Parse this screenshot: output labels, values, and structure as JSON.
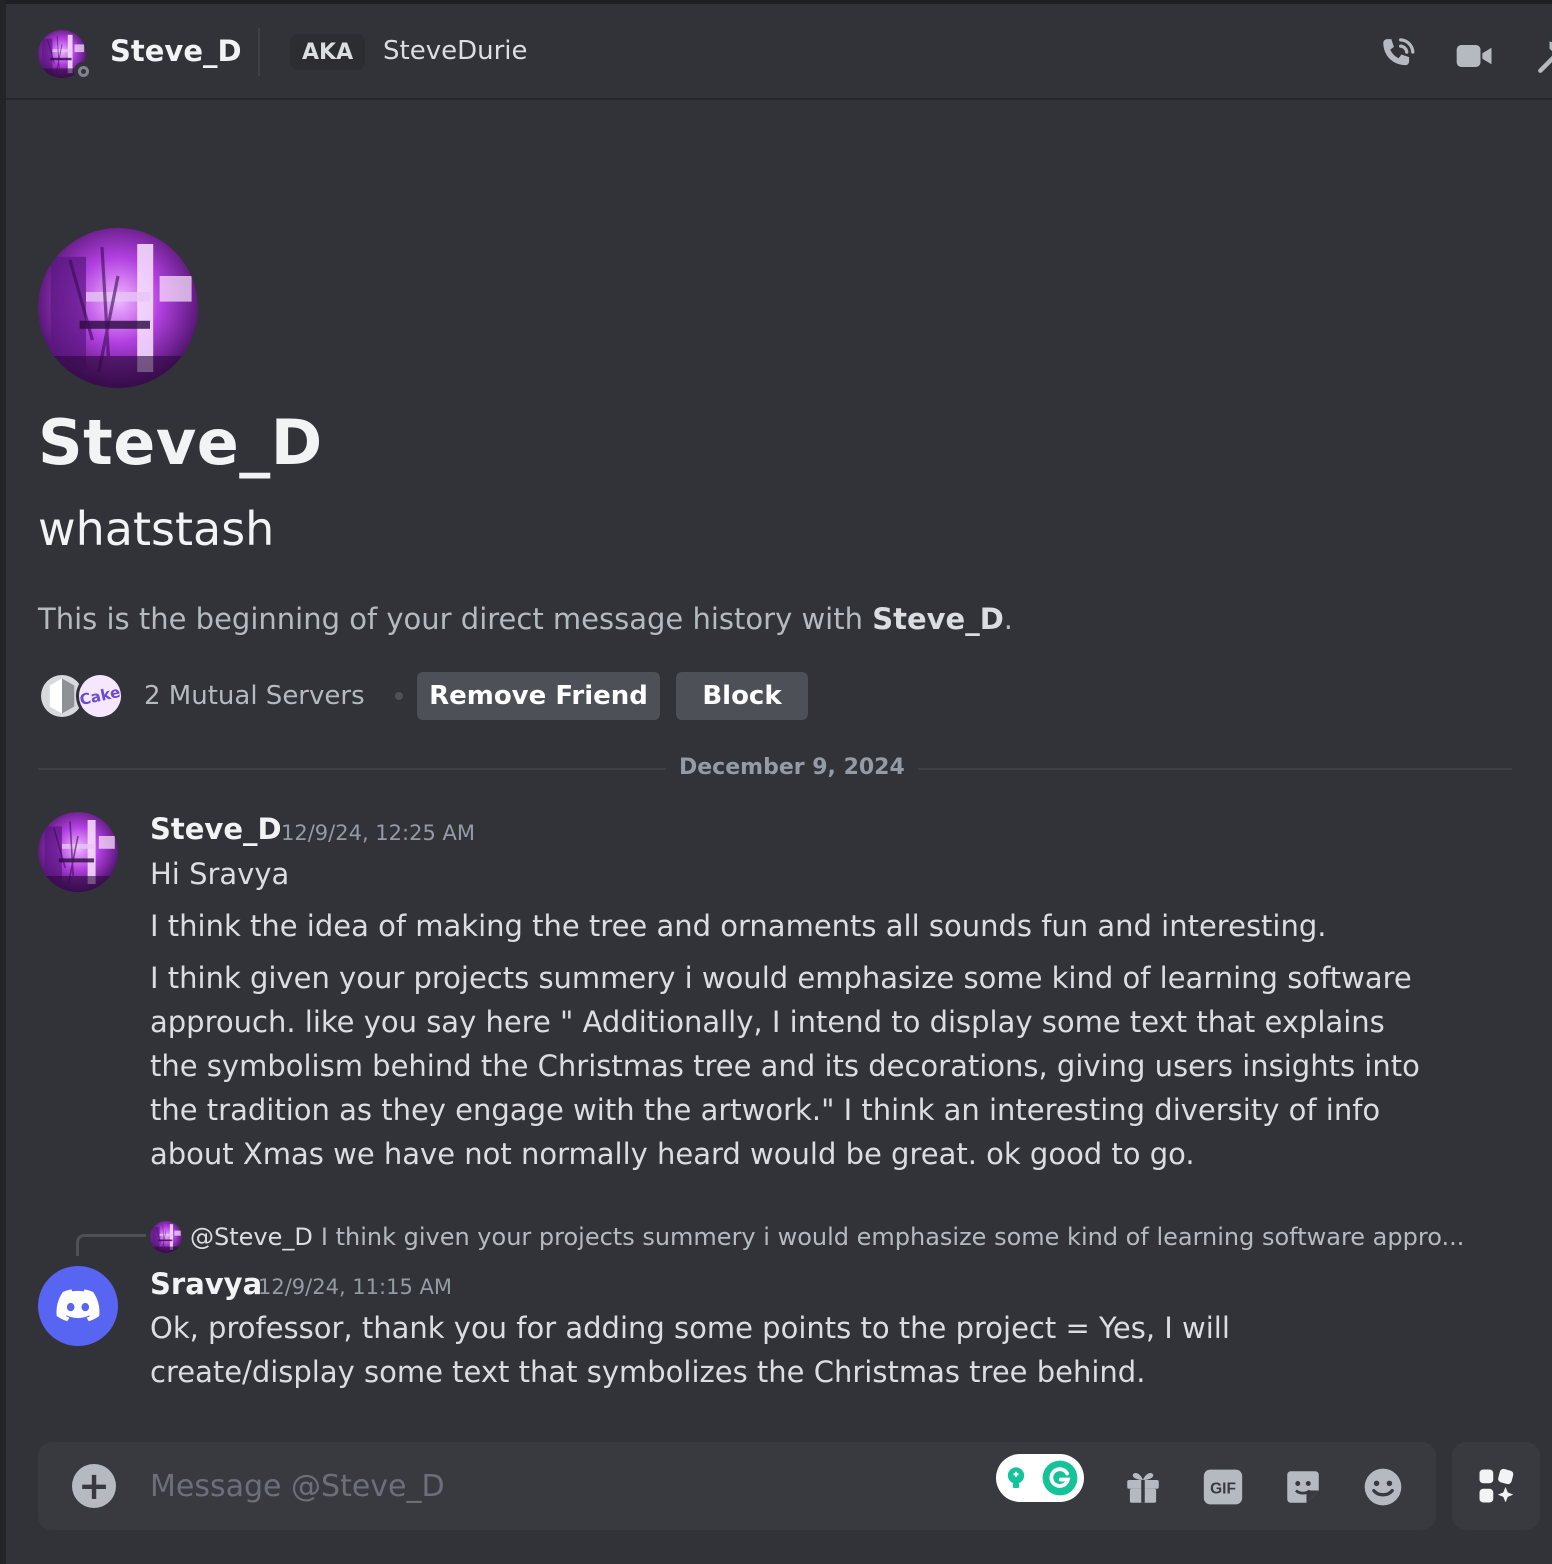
{
  "header": {
    "name": "Steve_D",
    "aka_label": "AKA",
    "aka_name": "SteveDurie"
  },
  "intro": {
    "display_name": "Steve_D",
    "username": "whatstash",
    "history_prefix": "This is the beginning of your direct message history with ",
    "history_name": "Steve_D",
    "history_suffix": ".",
    "server2_text": "Cake",
    "mutual_label": "2 Mutual Servers",
    "remove_friend_label": "Remove Friend",
    "block_label": "Block"
  },
  "divider_date": "December 9, 2024",
  "messages": [
    {
      "author": "Steve_D",
      "timestamp": "12/9/24, 12:25 AM",
      "lines": [
        "Hi Sravya",
        "I think the idea of making the tree and ornaments all sounds fun and interesting.",
        "I think given your projects summery i would emphasize some kind of learning software approuch.  like you say here \"  Additionally, I intend to display some text that explains the symbolism behind the Christmas tree and its decorations, giving users insights into the tradition as they engage with the artwork.\"   I think an interesting diversity of info about Xmas we have not normally heard would be great.  ok good to go."
      ]
    },
    {
      "reply_mention": "@Steve_D",
      "reply_text": "I think given your projects summery i would emphasize some kind of learning software appro...",
      "author": "Sravya",
      "timestamp": "12/9/24, 11:15 AM",
      "lines": [
        "Ok, professor, thank you for adding some points to the project = Yes, I will create/display some text that symbolizes the Christmas tree behind."
      ]
    }
  ],
  "composer": {
    "placeholder": "Message @Steve_D",
    "gif_label": "GIF"
  },
  "colors": {
    "background": "#313338",
    "composer": "#383a40",
    "button": "#4e5058",
    "blurple": "#5865f2",
    "grammarly_green": "#15c39a"
  },
  "icons": [
    "call-icon",
    "video-icon",
    "pin-icon",
    "plus-icon",
    "grammarly-icon",
    "gift-icon",
    "gif-icon",
    "sticker-icon",
    "emoji-icon",
    "apps-icon"
  ]
}
